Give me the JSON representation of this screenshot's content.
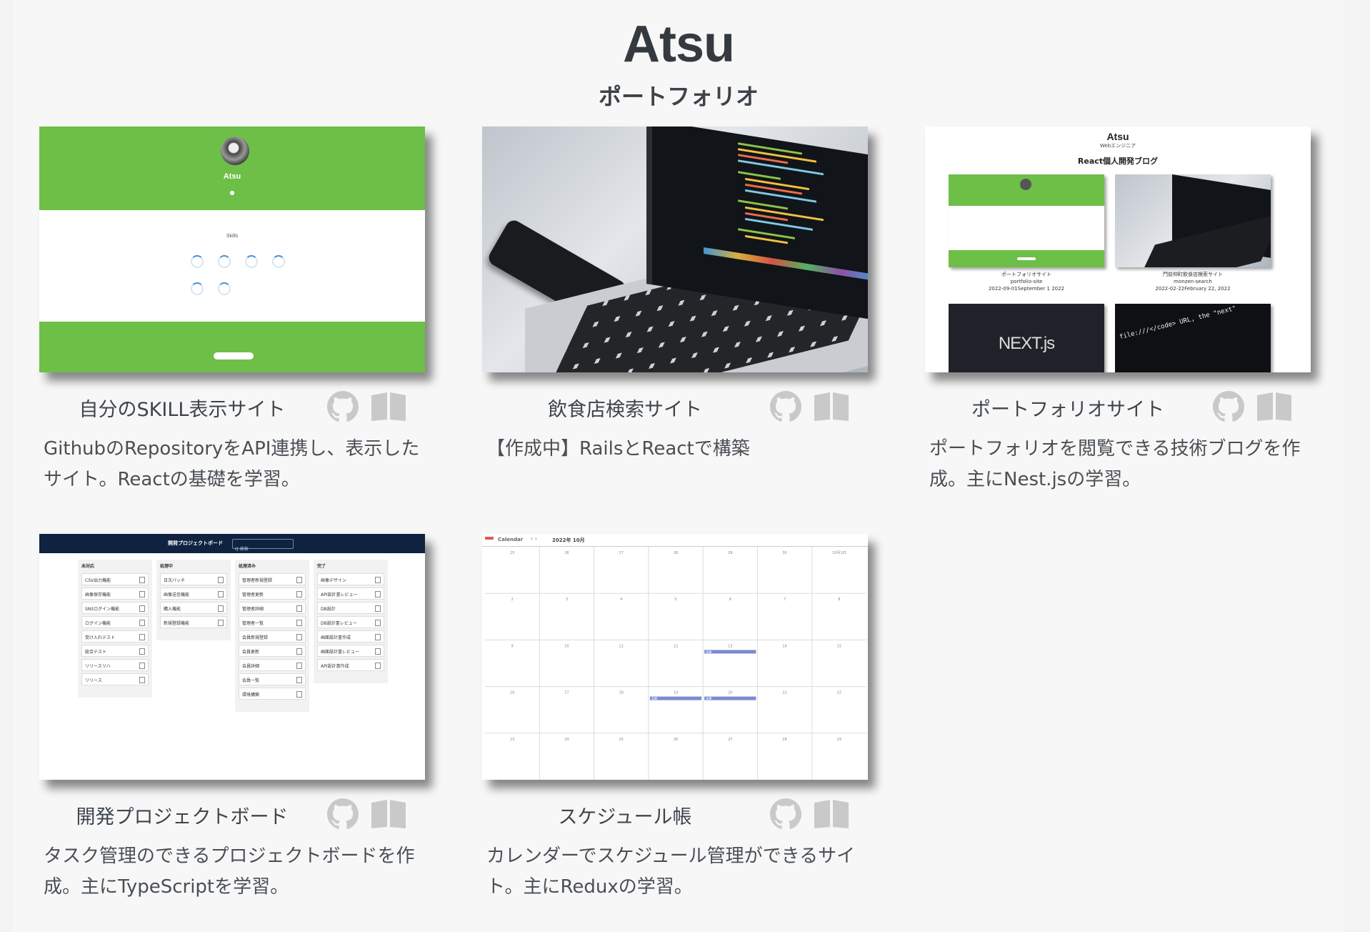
{
  "header": {
    "title": "Atsu",
    "subtitle": "ポートフォリオ"
  },
  "works": [
    {
      "title": "自分のSKILL表示サイト",
      "description": "GithubのRepositoryをAPI連携し、表示したサイト。Reactの基礎を学習。",
      "github_icon": "github-icon",
      "book_icon": "book-open-icon",
      "thumb": {
        "name": "Atsu",
        "section": "Skills",
        "button": ""
      }
    },
    {
      "title": "飲食店検索サイト",
      "description": "【作成中】RailsとReactで構築",
      "github_icon": "github-icon",
      "book_icon": "book-open-icon"
    },
    {
      "title": "ポートフォリオサイト",
      "description": "ポートフォリオを閲覧できる技術ブログを作成。主にNest.jsの学習。",
      "github_icon": "github-icon",
      "book_icon": "book-open-icon",
      "thumb": {
        "name": "Atsu",
        "role": "Webエンジニア",
        "heading": "React個人開発ブログ",
        "posts": [
          {
            "title": "ポートフォリオサイト",
            "slug": "portfolio-site",
            "date": "2022-09-01September 1 2022"
          },
          {
            "title": "門前仲町飲食店検索サイト",
            "slug": "monzen-search",
            "date": "2022-02-22February 22, 2022"
          }
        ],
        "next_logo": "NEXT.js",
        "code_text": "file:///</code> URL, the \"next\""
      }
    },
    {
      "title": "開発プロジェクトボード",
      "description": "タスク管理のできるプロジェクトボードを作成。主にTypeScriptを学習。",
      "github_icon": "github-icon",
      "book_icon": "book-open-icon",
      "thumb": {
        "board_title": "開発プロジェクトボード",
        "search_placeholder": "Q 検索",
        "lanes": [
          {
            "name": "未対応",
            "tasks": [
              "CSV出力機能",
              "画像保存機能",
              "SNSログイン機能",
              "ログイン機能",
              "受け入れテスト",
              "総合テスト",
              "リリースリハ",
              "リリース"
            ]
          },
          {
            "name": "処理中",
            "tasks": [
              "日次バッチ",
              "画像送信機能",
              "購入機能",
              "新規登録機能"
            ]
          },
          {
            "name": "処理済み",
            "tasks": [
              "管理者新規登録",
              "管理者更新",
              "管理者詳細",
              "管理者一覧",
              "会員新規登録",
              "会員更新",
              "会員詳細",
              "会員一覧",
              "環境構築"
            ]
          },
          {
            "name": "完了",
            "tasks": [
              "画像デザイン",
              "API設計書レビュー",
              "DB設計",
              "DB設計書レビュー",
              "画面設計書作成",
              "画面設計書レビュー",
              "API設計書作成"
            ]
          }
        ]
      }
    },
    {
      "title": "スケジュール帳",
      "description": "カレンダーでスケジュール管理ができるサイト。主にReduxの学習。",
      "github_icon": "github-icon",
      "book_icon": "book-open-icon",
      "thumb": {
        "app_name": "Calendar",
        "month": "2022年 10月",
        "nav": "‹ ›",
        "day_numbers": [
          [
            "25",
            "26",
            "27",
            "28",
            "29",
            "30",
            "10月1日"
          ],
          [
            "2",
            "3",
            "4",
            "5",
            "6",
            "7",
            "8"
          ],
          [
            "9",
            "10",
            "11",
            "12",
            "13",
            "14",
            "15"
          ],
          [
            "16",
            "17",
            "18",
            "19",
            "20",
            "21",
            "22"
          ],
          [
            "23",
            "24",
            "25",
            "26",
            "27",
            "28",
            "29"
          ]
        ],
        "event_label": "会議"
      }
    }
  ],
  "colors": {
    "accent_green": "#6dbf47",
    "board_navy": "#0f2340",
    "event_purple": "#7d8ad1",
    "text_dark": "#343a40"
  }
}
